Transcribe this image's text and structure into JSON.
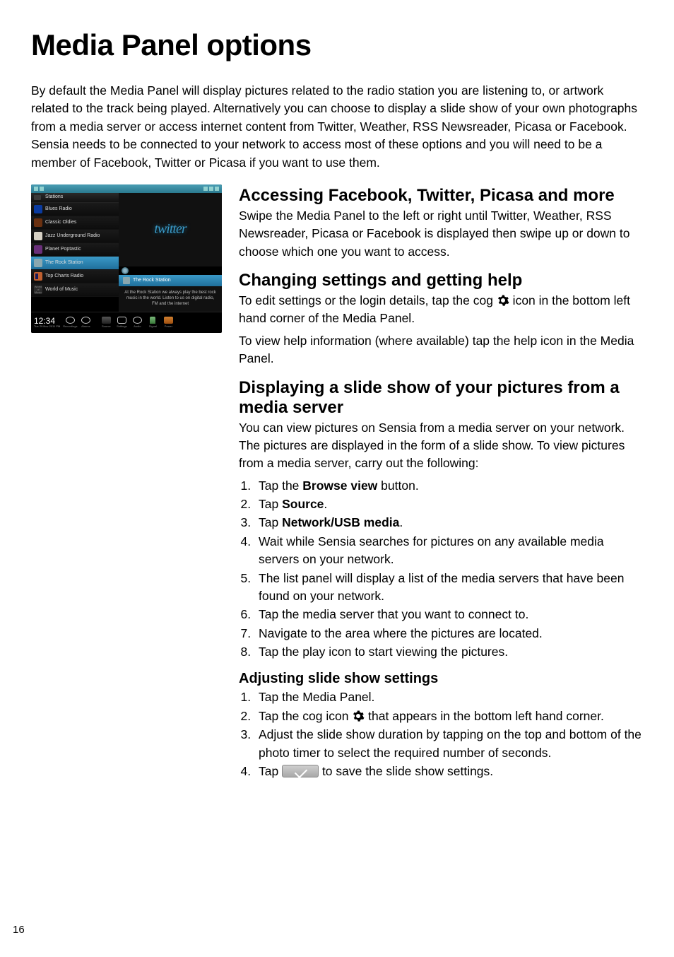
{
  "page_title": "Media Panel options",
  "intro": "By default the Media Panel will display pictures related to the radio station you are listening to, or artwork related to the track being played. Alternatively you can choose to display a slide show of your own photographs from a media server or access internet content from Twitter, Weather, RSS Newsreader, Picasa or Facebook. Sensia needs to be connected to your network to access most of these options and you will need to be a member of Facebook, Twitter or Picasa if you want to use them.",
  "device": {
    "list_header": "Stations",
    "items": [
      "Blues Radio",
      "Classic Oldies",
      "Jazz Underground Radio",
      "Planet Poptastic",
      "The Rock Station",
      "Top Charts Radio",
      "World of Music"
    ],
    "media_logo": "twitter",
    "now_bar": "The Rock Station",
    "desc": "At the Rock Station we always play the best rock music in the world. Listen to us on digital radio, FM and the internet",
    "clock": "12:34",
    "clock_sub": "Tue 29 Nov 2011 PM",
    "bottom_labels": [
      "Recordings",
      "Alarms",
      "Source",
      "Settings",
      "Audio",
      "Signal",
      "Power"
    ]
  },
  "sections": {
    "s1_h": "Accessing Facebook, Twitter, Picasa and more",
    "s1_p": "Swipe the Media Panel to the left or right until Twitter, Weather, RSS Newsreader, Picasa or Facebook is displayed then swipe up or down to choose which one you want to access.",
    "s2_h": "Changing settings and getting help",
    "s2_p1a": "To edit settings or the login details, tap the cog ",
    "s2_p1b": " icon in the bottom left hand corner of the Media Panel.",
    "s2_p2": "To view help information (where available) tap the help icon in the Media Panel.",
    "s3_h": "Displaying a slide show of your pictures from a media server",
    "s3_p": "You can view pictures on Sensia from a media server on your network. The pictures are displayed in the form of a slide show. To view pictures from a media server, carry out the following:",
    "s3_li1a": "Tap the ",
    "s3_li1b": "Browse view",
    "s3_li1c": " button.",
    "s3_li2a": "Tap ",
    "s3_li2b": "Source",
    "s3_li2c": ".",
    "s3_li3a": "Tap ",
    "s3_li3b": "Network/USB media",
    "s3_li3c": ".",
    "s3_li4": "Wait while Sensia searches for pictures on any available media servers on your network.",
    "s3_li5": "The list panel will display a list of the media servers that have been found on your network.",
    "s3_li6": "Tap the media server that you want to connect to.",
    "s3_li7": "Navigate to the area where the pictures are located.",
    "s3_li8": "Tap the play icon to start viewing the pictures.",
    "s4_h": "Adjusting slide show settings",
    "s4_li1": "Tap the Media Panel.",
    "s4_li2a": "Tap the cog icon ",
    "s4_li2b": " that appears in the bottom left hand corner.",
    "s4_li3": "Adjust the slide show duration by tapping on the top and bottom of the photo timer to select the required number of seconds.",
    "s4_li4a": "Tap ",
    "s4_li4b": " to save the slide show settings."
  },
  "page_number": "16"
}
